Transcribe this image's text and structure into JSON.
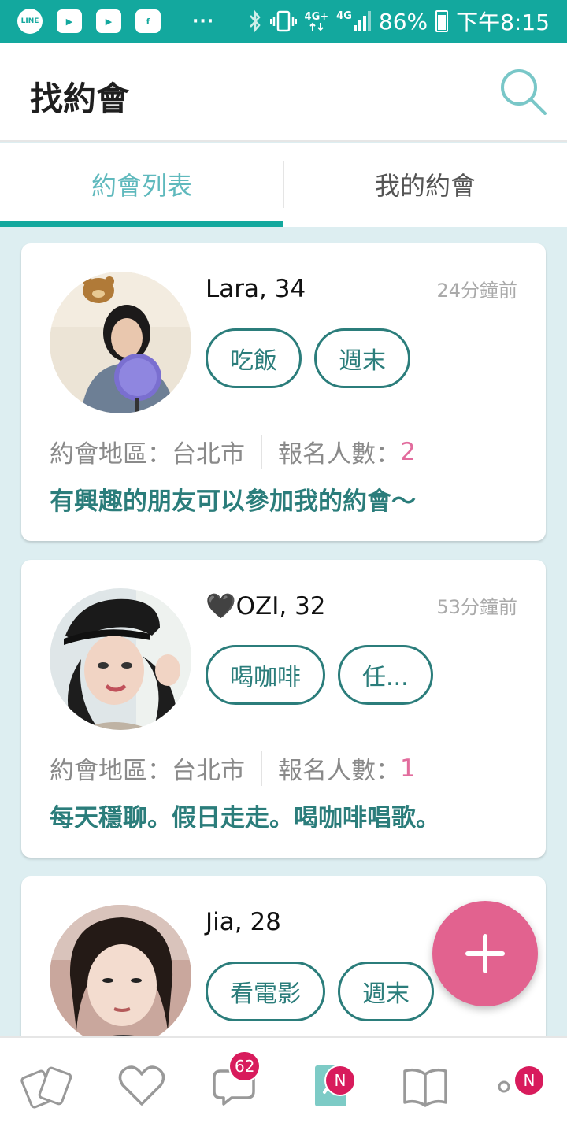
{
  "status_bar": {
    "apps": [
      "LINE",
      "▶",
      "▶",
      "f"
    ],
    "dots": "···",
    "network": "4G+",
    "network2": "4G",
    "battery": "86%",
    "time": "下午8:15"
  },
  "header": {
    "title": "找約會"
  },
  "tabs": [
    {
      "label": "約會列表"
    },
    {
      "label": "我的約會"
    }
  ],
  "dates": [
    {
      "name": "Lara, 34",
      "time": "24分鐘前",
      "tags": [
        "吃飯",
        "週末"
      ],
      "area_label": "約會地區：",
      "area": "台北市",
      "signup_label": "報名人數：",
      "signup_count": "2",
      "description": "有興趣的朋友可以參加我的約會～"
    },
    {
      "name": "🖤OZI, 32",
      "time": "53分鐘前",
      "tags": [
        "喝咖啡",
        "任..."
      ],
      "area_label": "約會地區：",
      "area": "台北市",
      "signup_label": "報名人數：",
      "signup_count": "1",
      "description": "每天穩聊。假日走走。喝咖啡唱歌。"
    },
    {
      "name": "Jia, 28",
      "tags": [
        "看電影",
        "週末"
      ]
    }
  ],
  "bottom_nav": [
    {
      "icon": "cards-icon"
    },
    {
      "icon": "heart-icon"
    },
    {
      "icon": "chat-icon",
      "badge": "62"
    },
    {
      "icon": "dating-icon",
      "badge": "N"
    },
    {
      "icon": "book-icon"
    },
    {
      "icon": "more-icon",
      "badge": "N"
    }
  ],
  "colors": {
    "primary": "#13a89e",
    "accent": "#e2628f",
    "tag": "#2b7d7b",
    "background": "#ddeef1"
  }
}
